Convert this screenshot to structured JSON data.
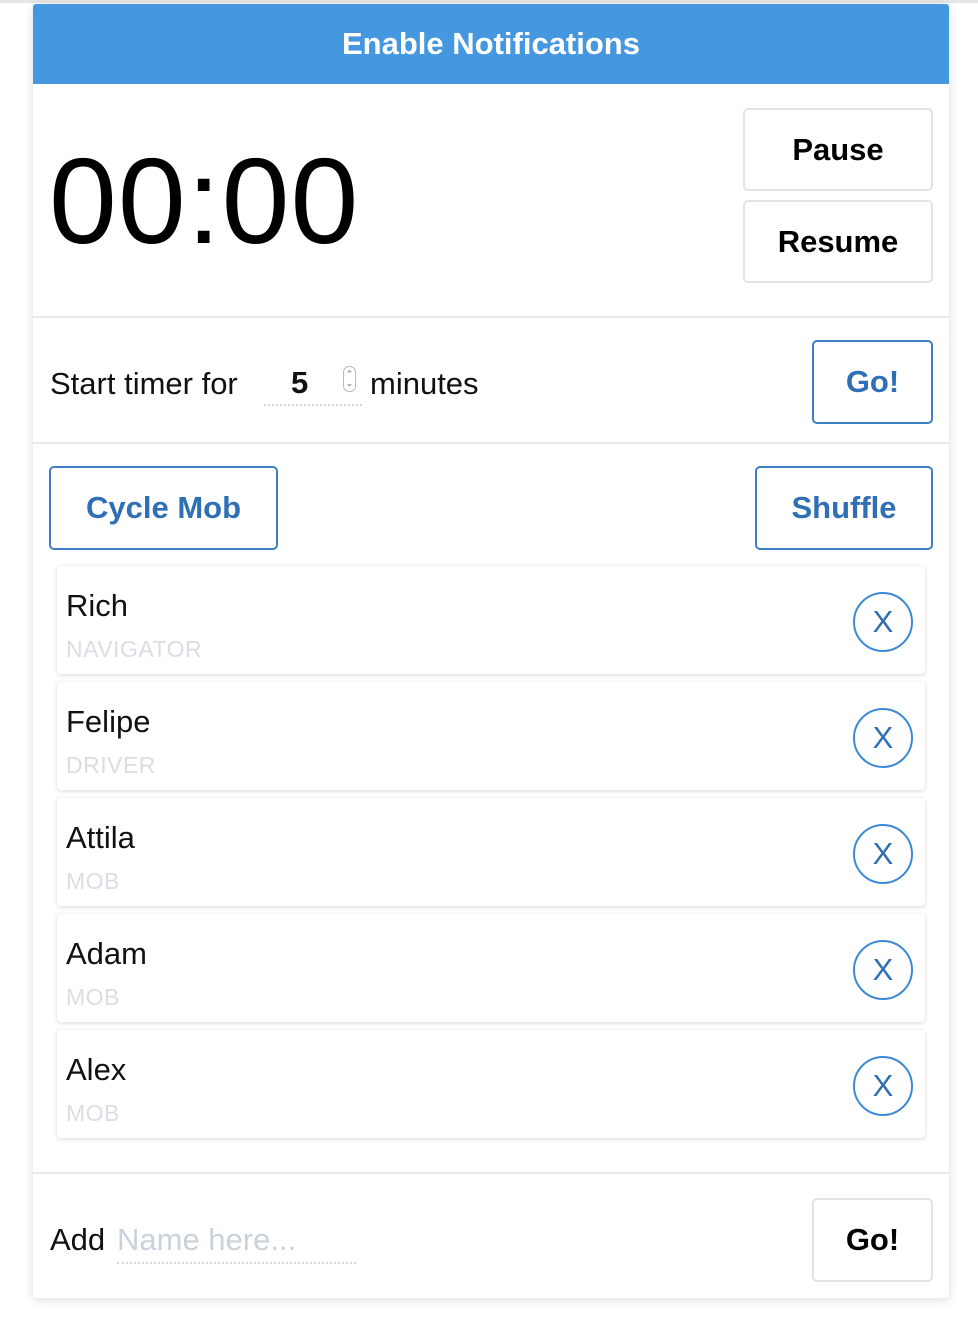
{
  "notifications": {
    "label": "Enable Notifications"
  },
  "timer": {
    "display": "00:00",
    "pause_label": "Pause",
    "resume_label": "Resume"
  },
  "start_timer": {
    "label": "Start timer for",
    "minutes_value": "5",
    "unit": "minutes",
    "go_label": "Go!"
  },
  "mob": {
    "cycle_label": "Cycle Mob",
    "shuffle_label": "Shuffle",
    "members": [
      {
        "name": "Rich",
        "role": "NAVIGATOR",
        "remove_label": "X"
      },
      {
        "name": "Felipe",
        "role": "DRIVER",
        "remove_label": "X"
      },
      {
        "name": "Attila",
        "role": "MOB",
        "remove_label": "X"
      },
      {
        "name": "Adam",
        "role": "MOB",
        "remove_label": "X"
      },
      {
        "name": "Alex",
        "role": "MOB",
        "remove_label": "X"
      }
    ]
  },
  "add_member": {
    "label": "Add",
    "placeholder": "Name here...",
    "value": "",
    "go_label": "Go!"
  },
  "colors": {
    "accent": "#4597e0",
    "button_blue": "#2e6fb6",
    "role_text": "#dadee3"
  }
}
